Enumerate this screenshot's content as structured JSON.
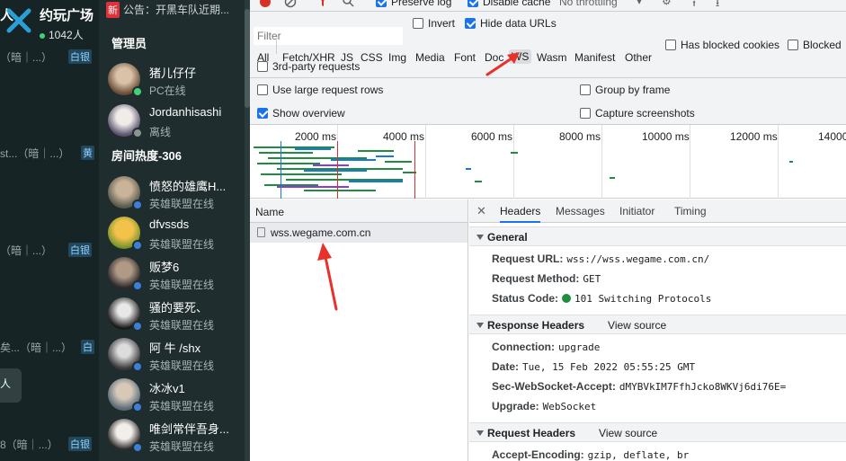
{
  "chat": {
    "room_title": "约玩广场",
    "online_count": "1042人",
    "left_partial": "人",
    "lines": [
      {
        "text": "（暗｜...）",
        "badge": "白银"
      },
      {
        "text": "st...（暗｜...）",
        "badge": "黄"
      },
      {
        "text": "（暗｜...）",
        "badge": "白银"
      },
      {
        "text": "矣...（暗｜...）",
        "badge": "白"
      },
      {
        "text": "（暗｜...）",
        "badge": "白银"
      }
    ],
    "bubble_text": "人",
    "bottom_line": {
      "text": "8（暗｜...）",
      "badge": "白银"
    }
  },
  "members": {
    "notice_badge": "新",
    "notice": "公告：开黑车队近期...",
    "admin_title": "管理员",
    "room_heat_title": "房间热度-306",
    "admins": [
      {
        "name": "猪儿仔仔",
        "status": "PC在线",
        "color": "#41d07a"
      },
      {
        "name": "Jordanhisashi",
        "status": "离线",
        "color": "#8a9494"
      }
    ],
    "users": [
      {
        "name": "愤怒的雄鹰H...",
        "status": "英雄联盟在线"
      },
      {
        "name": "dfvssds",
        "status": "英雄联盟在线"
      },
      {
        "name": "贩梦6",
        "status": "英雄联盟在线"
      },
      {
        "name": "骚的要死、",
        "status": "英雄联盟在线"
      },
      {
        "name": "阿 牛 /shx",
        "status": "英雄联盟在线"
      },
      {
        "name": "冰冰v1",
        "status": "英雄联盟在线"
      },
      {
        "name": "唯剑常伴吾身...",
        "status": "英雄联盟在线"
      }
    ],
    "status_color": "#3d7ed8"
  },
  "devtools": {
    "top": {
      "preserve_log": "Preserve log",
      "disable_cache": "Disable cache",
      "throttling": "No throttling"
    },
    "filter_placeholder": "Filter",
    "invert": "Invert",
    "hide_data_urls": "Hide data URLs",
    "types": [
      "All",
      "Fetch/XHR",
      "JS",
      "CSS",
      "Img",
      "Media",
      "Font",
      "Doc",
      "WS",
      "Wasm",
      "Manifest",
      "Other"
    ],
    "selected_type": "WS",
    "has_blocked_cookies": "Has blocked cookies",
    "blocked": "Blocked",
    "third_party": "3rd-party requests",
    "options": {
      "large_rows": "Use large request rows",
      "group_by_frame": "Group by frame",
      "show_overview": "Show overview",
      "capture_screenshots": "Capture screenshots"
    },
    "timeline_ticks": [
      "2000 ms",
      "4000 ms",
      "6000 ms",
      "8000 ms",
      "10000 ms",
      "12000 ms",
      "14000"
    ],
    "name_header": "Name",
    "request_name": "wss.wegame.com.cn",
    "tabs": [
      "Headers",
      "Messages",
      "Initiator",
      "Timing"
    ],
    "selected_tab": "Headers",
    "general": {
      "title": "General",
      "request_url_label": "Request URL:",
      "request_url": "wss://wss.wegame.com.cn/",
      "request_method_label": "Request Method:",
      "request_method": "GET",
      "status_code_label": "Status Code:",
      "status_code": "101 Switching Protocols"
    },
    "response_headers": {
      "title": "Response Headers",
      "view_source": "View source",
      "connection_label": "Connection:",
      "connection": "upgrade",
      "date_label": "Date:",
      "date": "Tue, 15 Feb 2022 05:55:25 GMT",
      "ws_accept_label": "Sec-WebSocket-Accept:",
      "ws_accept": "dMYBVkIM7FfhJcko8WKVj6di76E=",
      "upgrade_label": "Upgrade:",
      "upgrade": "WebSocket"
    },
    "request_headers": {
      "title": "Request Headers",
      "view_source": "View source",
      "accept_encoding_label": "Accept-Encoding:",
      "accept_encoding": "gzip, deflate, br"
    },
    "accent_color": "#1a73e8",
    "annotation_color": "#e8312a"
  }
}
